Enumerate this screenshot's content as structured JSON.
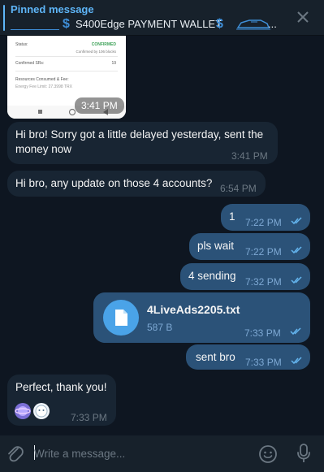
{
  "pinned": {
    "title": "Pinned message",
    "preview": "S400Edge PAYMENT WALLET",
    "ellipsis": "..."
  },
  "messages": [
    {
      "type": "image",
      "time": "3:41 PM",
      "screenshot": {
        "status_label": "Status:",
        "status_value": "CONFIRMED",
        "status_sub": "Confirmed by 106 blocks",
        "confirmed_srs_label": "Confirmed SRs:",
        "confirmed_srs_value": "19",
        "resources_label": "Resources Consumed & Fee:",
        "energy_note": "Energy Fee Limit: 27.3998 TRX"
      }
    },
    {
      "type": "text",
      "direction": "in",
      "text": "Hi bro! Sorry got a little delayed yesterday, sent the money now",
      "time": "3:41 PM"
    },
    {
      "type": "text",
      "direction": "in",
      "text": "Hi bro, any update on those 4 accounts?",
      "time": "6:54 PM"
    },
    {
      "type": "text",
      "direction": "out",
      "text": "1",
      "time": "7:22 PM",
      "read": true
    },
    {
      "type": "text",
      "direction": "out",
      "text": "pls wait",
      "time": "7:22 PM",
      "read": true
    },
    {
      "type": "text",
      "direction": "out",
      "text": "4 sending",
      "time": "7:32 PM",
      "read": true
    },
    {
      "type": "file",
      "direction": "out",
      "filename": "4LiveAds2205.txt",
      "size": "587 B",
      "time": "7:33 PM",
      "read": true
    },
    {
      "type": "text",
      "direction": "out",
      "text": "sent bro",
      "time": "7:33 PM",
      "read": true
    },
    {
      "type": "text",
      "direction": "in",
      "text": "Perfect, thank you!",
      "time": "7:33 PM",
      "has_emoji": true
    }
  ],
  "composer": {
    "placeholder": "Write a message..."
  },
  "colors": {
    "background": "#0e1621",
    "header": "#17212b",
    "incoming": "#182533",
    "outgoing": "#2b5278",
    "accent": "#5eb5f7",
    "muted": "#6c7883"
  },
  "icons": {
    "close": "close-icon",
    "attach": "paperclip-icon",
    "emoji": "smile-icon",
    "mic": "microphone-icon",
    "file": "document-icon",
    "read": "double-check-icon"
  }
}
